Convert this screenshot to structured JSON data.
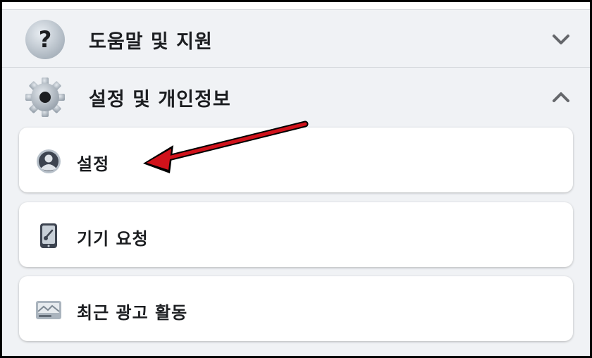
{
  "menu": {
    "help_section": {
      "label": "도움말 및 지원",
      "icon": "question-icon",
      "expanded": false
    },
    "settings_section": {
      "label": "설정 및 개인정보",
      "icon": "gear-icon",
      "expanded": true
    },
    "items": [
      {
        "label": "설정",
        "icon": "profile-icon"
      },
      {
        "label": "기기 요청",
        "icon": "device-icon"
      },
      {
        "label": "최근 광고 활동",
        "icon": "ad-image-icon"
      }
    ]
  },
  "annotation": {
    "type": "arrow",
    "color": "#d0121b",
    "points_to": "설정"
  }
}
